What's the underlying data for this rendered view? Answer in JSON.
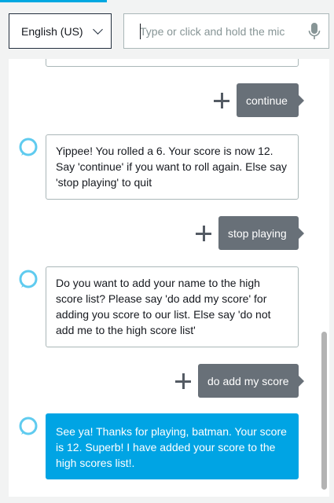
{
  "header": {
    "language": "English (US)",
    "utterance_placeholder": "Type or click and hold the mic"
  },
  "conversation": [
    {
      "from": "alexa",
      "text": ""
    },
    {
      "from": "user",
      "text": "continue"
    },
    {
      "from": "alexa",
      "text": "Yippee! You rolled a 6. Your score is now 12. Say 'continue' if you want to roll again. Else say 'stop playing' to quit"
    },
    {
      "from": "user",
      "text": "stop playing"
    },
    {
      "from": "alexa",
      "text": "Do you want to add your name to the high score list? Please say 'do add my score' for adding you score to our list. Else say 'do not add me to the high score list'"
    },
    {
      "from": "user",
      "text": "do add my score"
    },
    {
      "from": "alexa",
      "text": "See ya! Thanks for playing, batman. Your score is 12. Superb! I have added your score to the high scores list!."
    }
  ],
  "icons": {
    "mic": "microphone-icon",
    "plus": "plus-icon",
    "alexa": "alexa-ring-icon",
    "chevron": "chevron-down-icon"
  },
  "colors": {
    "accent": "#00a4e4",
    "user_bubble": "#687078",
    "border": "#aab7b8",
    "alexa_ring": "#5fcbef"
  }
}
